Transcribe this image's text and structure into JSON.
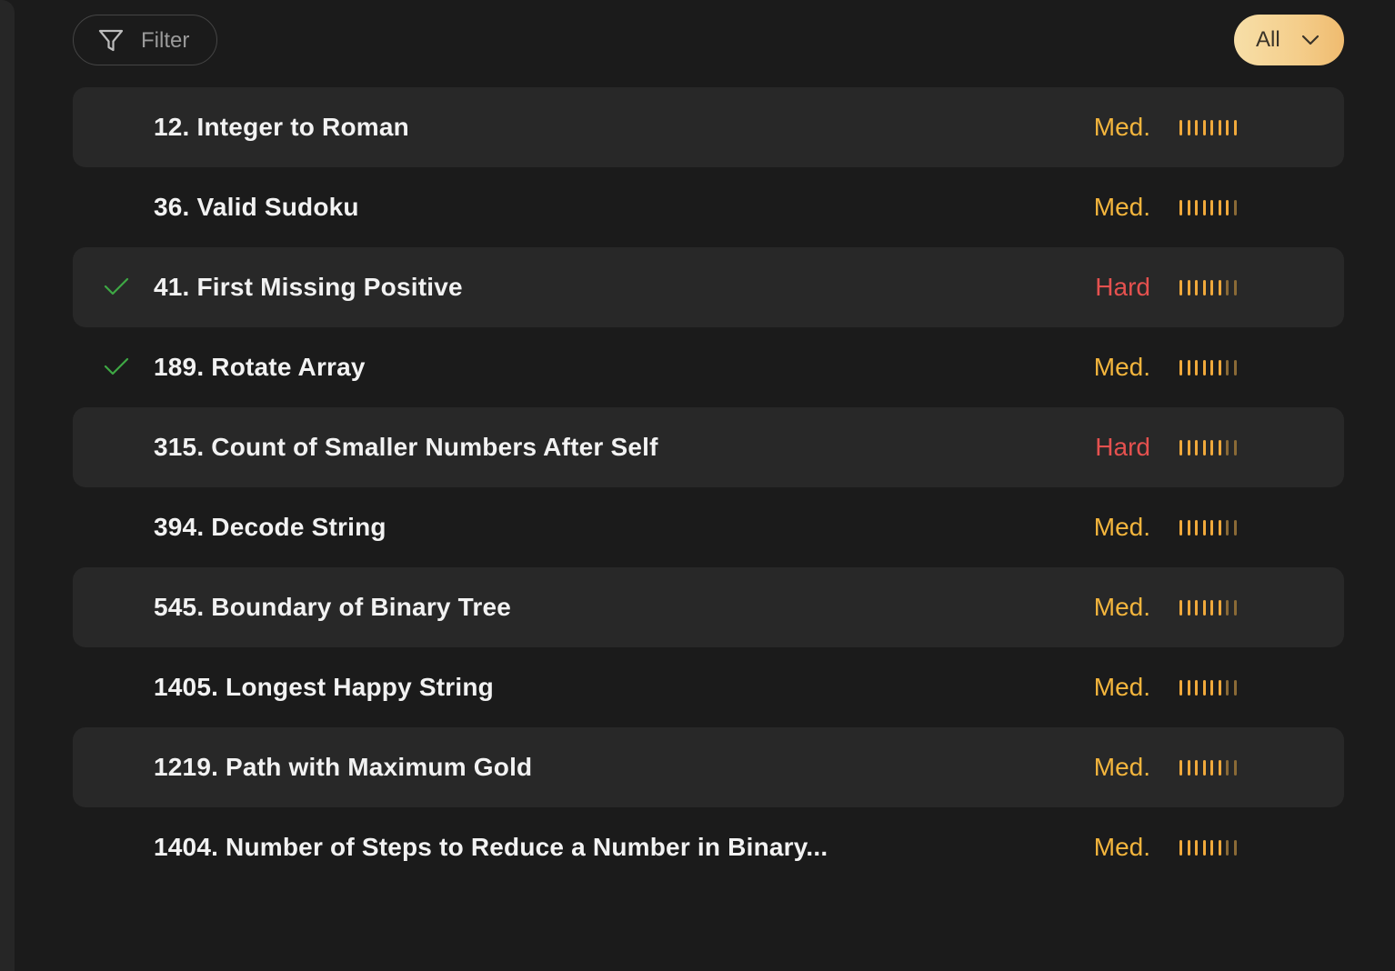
{
  "toolbar": {
    "filter_label": "Filter",
    "filter_icon": "filter-funnel-icon",
    "scope_label": "All",
    "scope_icon": "chevron-down-icon"
  },
  "colors": {
    "medium": "#f3b53d",
    "hard": "#e5514f",
    "check": "#3ea844",
    "bar_active": "#f0a93b",
    "bar_inactive": "#8a6a36"
  },
  "problems": [
    {
      "title": "12. Integer to Roman",
      "difficulty": "Med.",
      "level": "medium",
      "solved": false,
      "frequency": 8,
      "frequency_max": 8
    },
    {
      "title": "36. Valid Sudoku",
      "difficulty": "Med.",
      "level": "medium",
      "solved": false,
      "frequency": 7,
      "frequency_max": 8
    },
    {
      "title": "41. First Missing Positive",
      "difficulty": "Hard",
      "level": "hard",
      "solved": true,
      "frequency": 6,
      "frequency_max": 8
    },
    {
      "title": "189. Rotate Array",
      "difficulty": "Med.",
      "level": "medium",
      "solved": true,
      "frequency": 6,
      "frequency_max": 8
    },
    {
      "title": "315. Count of Smaller Numbers After Self",
      "difficulty": "Hard",
      "level": "hard",
      "solved": false,
      "frequency": 6,
      "frequency_max": 8
    },
    {
      "title": "394. Decode String",
      "difficulty": "Med.",
      "level": "medium",
      "solved": false,
      "frequency": 6,
      "frequency_max": 8
    },
    {
      "title": "545. Boundary of Binary Tree",
      "difficulty": "Med.",
      "level": "medium",
      "solved": false,
      "frequency": 6,
      "frequency_max": 8
    },
    {
      "title": "1405. Longest Happy String",
      "difficulty": "Med.",
      "level": "medium",
      "solved": false,
      "frequency": 6,
      "frequency_max": 8
    },
    {
      "title": "1219. Path with Maximum Gold",
      "difficulty": "Med.",
      "level": "medium",
      "solved": false,
      "frequency": 6,
      "frequency_max": 8
    },
    {
      "title": "1404. Number of Steps to Reduce a Number in Binary...",
      "difficulty": "Med.",
      "level": "medium",
      "solved": false,
      "frequency": 6,
      "frequency_max": 8
    }
  ]
}
